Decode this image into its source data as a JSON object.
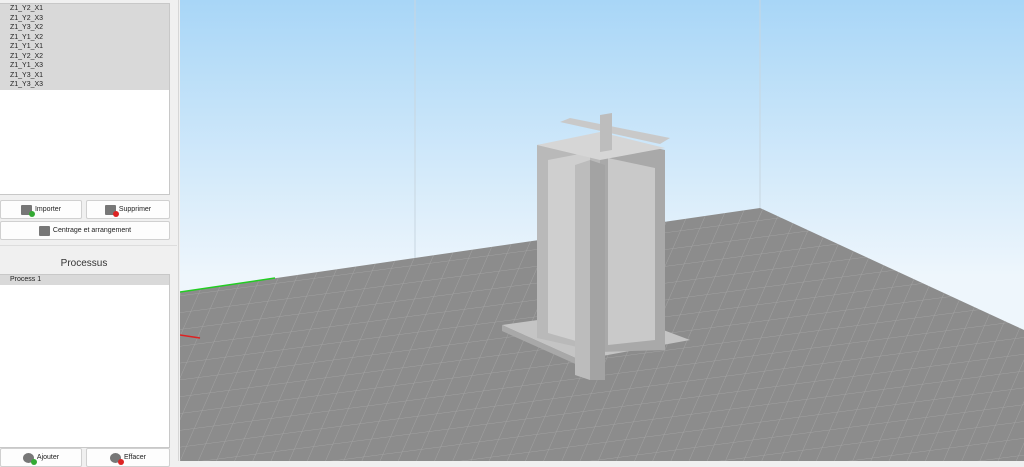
{
  "objects": [
    "Z1_Y2_X1",
    "Z1_Y2_X3",
    "Z1_Y3_X2",
    "Z1_Y1_X2",
    "Z1_Y1_X1",
    "Z1_Y2_X2",
    "Z1_Y1_X3",
    "Z1_Y3_X1",
    "Z1_Y3_X3"
  ],
  "buttons": {
    "import": "Importer",
    "delete": "Supprimer",
    "arrange": "Centrage et arrangement",
    "add": "Ajouter",
    "clear": "Effacer"
  },
  "process": {
    "title": "Processus",
    "items": [
      "Process 1"
    ]
  },
  "colors": {
    "sky_top": "#a8d6f7",
    "floor": "#8a8a8a",
    "selection": "#d9d9d9"
  }
}
